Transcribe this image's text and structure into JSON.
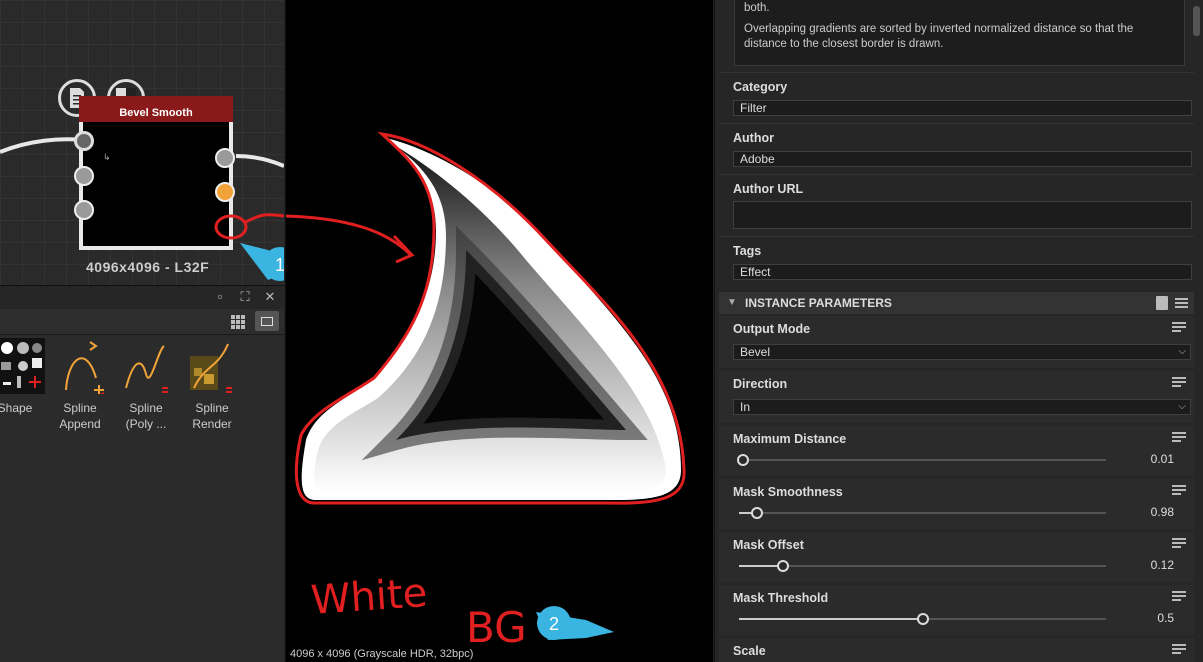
{
  "graph": {
    "node_title": "Bevel Smooth",
    "node_resolution": "4096x4096 - L32F",
    "port_glyph": "↳",
    "document_button_icon": "document-icon",
    "checker_button_icon": "checker-icon"
  },
  "library": {
    "items": [
      {
        "label_line1": "Shape",
        "label_line2": ""
      },
      {
        "label_line1": "Spline",
        "label_line2": "Append"
      },
      {
        "label_line1": "Spline",
        "label_line2": "(Poly ..."
      },
      {
        "label_line1": "Spline",
        "label_line2": "Render"
      }
    ]
  },
  "viewer": {
    "status": "4096 x 4096 (Grayscale HDR, 32bpc)",
    "annotation_text_1": "White",
    "annotation_text_2": "BG",
    "badge_1": "1",
    "badge_2": "2"
  },
  "properties": {
    "description_line1": "both.",
    "description_line2": "Overlapping gradients are sorted by inverted normalized distance so that the",
    "description_line3": "distance to the closest border is drawn.",
    "category_label": "Category",
    "category_value": "Filter",
    "author_label": "Author",
    "author_value": "Adobe",
    "author_url_label": "Author URL",
    "author_url_value": "",
    "tags_label": "Tags",
    "tags_value": "Effect",
    "section_title": "INSTANCE PARAMETERS",
    "output_mode_label": "Output Mode",
    "output_mode_value": "Bevel",
    "direction_label": "Direction",
    "direction_value": "In",
    "max_distance_label": "Maximum Distance",
    "max_distance_value": "0.01",
    "max_distance_level": 0.01,
    "mask_smoothness_label": "Mask Smoothness",
    "mask_smoothness_value": "0.98",
    "mask_smoothness_level": 0.05,
    "mask_offset_label": "Mask Offset",
    "mask_offset_value": "0.12",
    "mask_offset_level": 0.12,
    "mask_threshold_label": "Mask Threshold",
    "mask_threshold_value": "0.5",
    "mask_threshold_level": 0.5,
    "scale_label": "Scale"
  },
  "colors": {
    "node_header": "#8a1a1a",
    "annotation_red": "#e02020",
    "badge_blue": "#3ab4e0",
    "port_orange": "#f1a33a"
  }
}
